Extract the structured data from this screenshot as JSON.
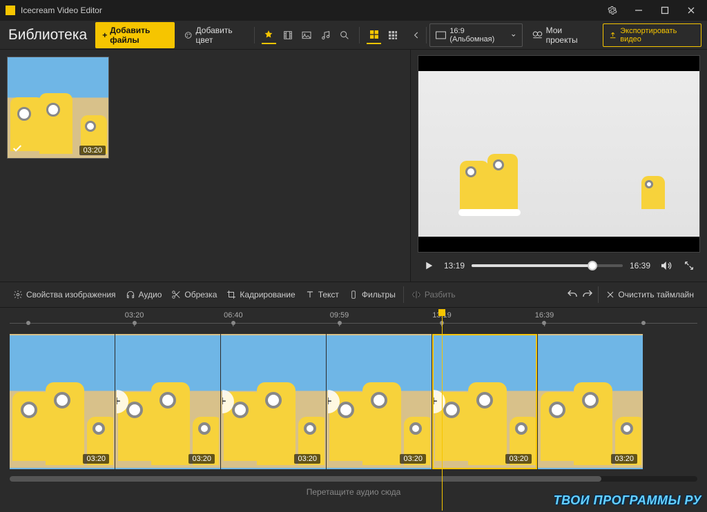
{
  "window": {
    "title": "Icecream Video Editor"
  },
  "toolbar": {
    "library_title": "Библиотека",
    "add_files": "Добавить файлы",
    "add_color": "Добавить цвет",
    "aspect_ratio": "16:9 (Альбомная)",
    "my_projects": "Мои проекты",
    "export_video": "Экспортировать видео"
  },
  "library": {
    "items": [
      {
        "duration": "03:20",
        "selected": true
      }
    ]
  },
  "preview": {
    "current_time": "13:19",
    "total_time": "16:39",
    "progress_pct": 80
  },
  "clip_toolbar": {
    "image_props": "Свойства изображения",
    "audio": "Аудио",
    "trim": "Обрезка",
    "crop": "Кадрирование",
    "text": "Текст",
    "filters": "Фильтры",
    "split": "Разбить",
    "clear_timeline": "Очистить таймлайн"
  },
  "ruler": {
    "ticks": [
      {
        "label": "03:20",
        "pct": 19
      },
      {
        "label": "06:40",
        "pct": 33
      },
      {
        "label": "09:59",
        "pct": 48
      },
      {
        "label": "13:19",
        "pct": 62.5
      },
      {
        "label": "16:39",
        "pct": 77
      }
    ],
    "playhead_pct": 62.5
  },
  "timeline": {
    "clips": [
      {
        "duration": "03:20",
        "plus": false,
        "selected": false
      },
      {
        "duration": "03:20",
        "plus": true,
        "selected": false
      },
      {
        "duration": "03:20",
        "plus": true,
        "selected": false
      },
      {
        "duration": "03:20",
        "plus": true,
        "selected": false
      },
      {
        "duration": "03:20",
        "plus": true,
        "selected": true
      },
      {
        "duration": "03:20",
        "plus": false,
        "selected": false
      }
    ]
  },
  "audio_drop": "Перетащите аудио сюда",
  "watermark": "ТВОИ ПРОГРАММЫ РУ"
}
